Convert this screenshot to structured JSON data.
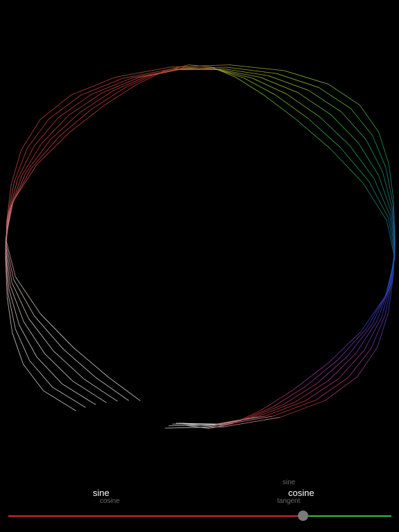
{
  "left_picker": {
    "selected": "sine",
    "below": "cosine"
  },
  "right_picker": {
    "above": "sine",
    "selected": "cosine",
    "below": "tangent"
  },
  "slider": {
    "value": 0.77,
    "min_color": "#cc2f2f",
    "max_color": "#33c43f",
    "thumb_color": "#7a7a7a"
  },
  "colors": {
    "background": "#000000",
    "curve_top": "#d8d8d8",
    "curve_left": "#c83c3c",
    "curve_bottom_left": "#9acd32",
    "curve_bottom": "#22aa44",
    "curve_bottom_right": "#2244cc",
    "curve_right": "#aa3399"
  }
}
